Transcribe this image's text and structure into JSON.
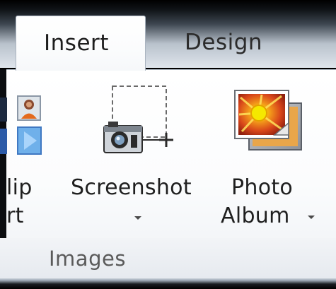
{
  "tabs": [
    {
      "label": "Insert",
      "active": true
    },
    {
      "label": "Design",
      "active": false
    }
  ],
  "group": {
    "label": "Images"
  },
  "commands": {
    "clip_art": {
      "line1": "lip",
      "line2": "rt",
      "icon": "clip-art-icon"
    },
    "screenshot": {
      "label": "Screenshot",
      "icon": "screenshot-camera-icon",
      "has_dropdown": true
    },
    "photo_album": {
      "line1": "Photo",
      "line2": "Album",
      "icon": "photo-album-icon",
      "has_dropdown": true
    }
  },
  "colors": {
    "ribbon_background": "#fbfcfd",
    "tab_border": "#a9b3bf",
    "text": "#1f1f1f",
    "group_label": "#5a5a5a",
    "photo_album_sun": "#f5d000",
    "photo_album_rays": "#e8591a",
    "clip_art_blue": "#5aa0e0"
  }
}
